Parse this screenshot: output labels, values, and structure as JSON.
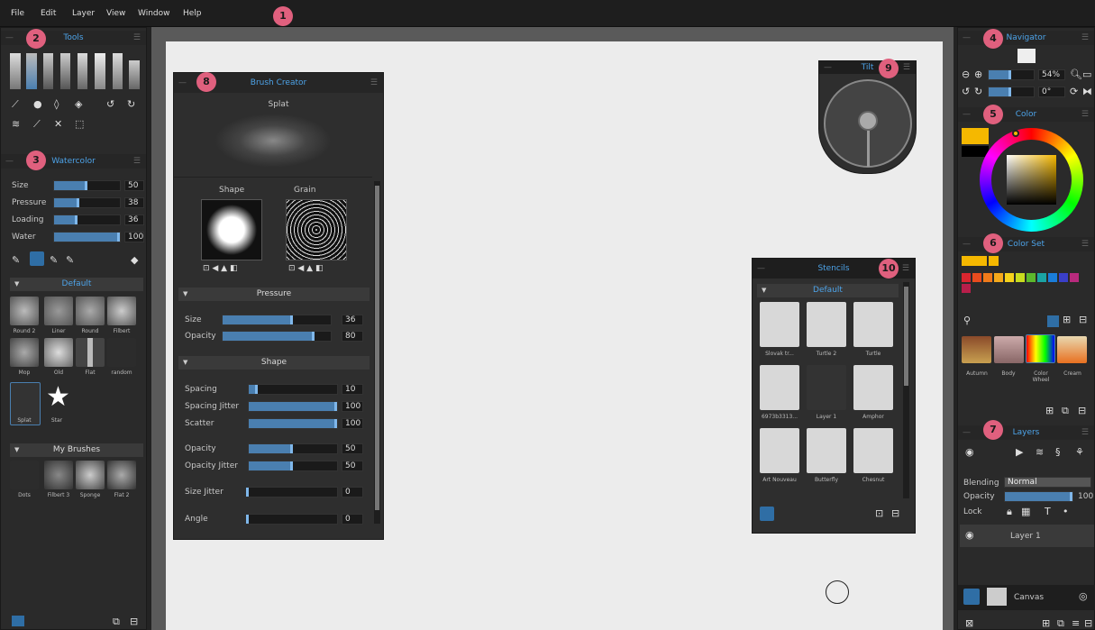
{
  "menu": [
    "File",
    "Edit",
    "Layer",
    "View",
    "Window",
    "Help"
  ],
  "badges": [
    "1",
    "2",
    "3",
    "4",
    "5",
    "6",
    "7",
    "8",
    "9",
    "10"
  ],
  "tools": {
    "title": "Tools"
  },
  "brush": {
    "title": "Watercolor",
    "sliders": [
      {
        "label": "Size",
        "value": "50",
        "fill": 0.5
      },
      {
        "label": "Pressure",
        "value": "38",
        "fill": 0.38
      },
      {
        "label": "Loading",
        "value": "36",
        "fill": 0.36
      },
      {
        "label": "Water",
        "value": "100",
        "fill": 1
      }
    ],
    "default_header": "Default",
    "default_brushes": [
      "Round 2",
      "Liner",
      "Round",
      "Filbert",
      "Mop",
      "Old",
      "Flat",
      "random",
      "Splat",
      "Star"
    ],
    "my_header": "My Brushes",
    "my_brushes": [
      "Dots",
      "Filbert 3",
      "Sponge",
      "Flat 2"
    ]
  },
  "creator": {
    "title": "Brush Creator",
    "name": "Splat",
    "shape_label": "Shape",
    "grain_label": "Grain",
    "pressure_header": "Pressure",
    "pressure": [
      {
        "label": "Size",
        "value": "36",
        "fill": 0.65
      },
      {
        "label": "Opacity",
        "value": "80",
        "fill": 0.85
      }
    ],
    "shape_header": "Shape",
    "shape": [
      {
        "label": "Spacing",
        "value": "10",
        "fill": 0.1
      },
      {
        "label": "Spacing Jitter",
        "value": "100",
        "fill": 1
      },
      {
        "label": "Scatter",
        "value": "100",
        "fill": 1
      },
      {
        "label": "Opacity",
        "value": "50",
        "fill": 0.5
      },
      {
        "label": "Opacity Jitter",
        "value": "50",
        "fill": 0.5
      },
      {
        "label": "Size Jitter",
        "value": "0",
        "fill": 0
      },
      {
        "label": "Angle",
        "value": "0",
        "fill": 0
      }
    ]
  },
  "tilt": {
    "title": "Tilt"
  },
  "stencils": {
    "title": "Stencils",
    "header": "Default",
    "items": [
      "Slovak tr...",
      "Turtle 2",
      "Turtle",
      "6973b3313...",
      "Layer 1",
      "Amphor",
      "Art Nouveau",
      "Butterfly",
      "Chesnut"
    ]
  },
  "navigator": {
    "title": "Navigator",
    "zoom": "54%",
    "rotation": "0°",
    "zoom_fill": 0.5,
    "rot_fill": 0.5
  },
  "color": {
    "title": "Color",
    "primary": "#f5b800"
  },
  "colorset": {
    "title": "Color Set",
    "sets": [
      "Autumn",
      "Body",
      "Color Wheel",
      "Cream"
    ],
    "colors": [
      "#f5b800",
      "#f5b800",
      "#d9262f",
      "#e84b1e",
      "#f07a1a",
      "#f5a91b",
      "#f5d21b",
      "#c8dc1e",
      "#5cb82c",
      "#1aa3a3",
      "#1a7dd9",
      "#3a3fc8",
      "#b82a7d",
      "#b81e4a"
    ]
  },
  "layers": {
    "title": "Layers",
    "blending_label": "Blending",
    "blending_value": "Normal",
    "opacity_label": "Opacity",
    "opacity_value": "100",
    "lock_label": "Lock",
    "layer": "Layer 1",
    "canvas": "Canvas"
  }
}
